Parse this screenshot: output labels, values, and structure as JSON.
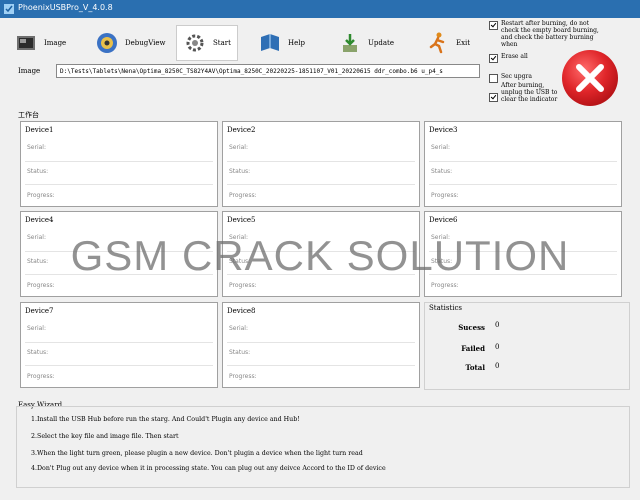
{
  "window": {
    "title": "PhoenixUSBPro_V_4.0.8"
  },
  "toolbar": {
    "image": "Image",
    "debugview": "DebugView",
    "start": "Start",
    "help": "Help",
    "update": "Update",
    "exit": "Exit"
  },
  "image_field": {
    "label": "Image",
    "value": "D:\\Tests\\Tablets\\Nena\\Optima_8250C_TS82Y4AV\\Optima_8250C_20220225-1851107_V01_20220615 ddr_combo.b6 u_p4_s"
  },
  "options": {
    "check_board": {
      "text": "Restart after burning, do not check the empty board burning, and check the battery burning when",
      "checked": true
    },
    "erase_all": {
      "text": "Erase all",
      "checked": true
    },
    "sec_upgrade": {
      "text": "Sec upgra",
      "checked": false
    },
    "unplug": {
      "text": "After burning, unplug the USB to clear the indicator",
      "checked": true
    }
  },
  "work_group_label": "工作台",
  "devices": [
    {
      "name": "Device1",
      "serial": "Serial:",
      "status": "Status:",
      "progress": "Progress:"
    },
    {
      "name": "Device2",
      "serial": "Serial:",
      "status": "Status:",
      "progress": "Progress:"
    },
    {
      "name": "Device3",
      "serial": "Serial:",
      "status": "Status:",
      "progress": "Progress:"
    },
    {
      "name": "Device4",
      "serial": "Serial:",
      "status": "Status:",
      "progress": "Progress:"
    },
    {
      "name": "Device5",
      "serial": "Serial:",
      "status": "Status:",
      "progress": "Progress:"
    },
    {
      "name": "Device6",
      "serial": "Serial:",
      "status": "Status:",
      "progress": "Progress:"
    },
    {
      "name": "Device7",
      "serial": "Serial:",
      "status": "Status:",
      "progress": "Progress:"
    },
    {
      "name": "Device8",
      "serial": "Serial:",
      "status": "Status:",
      "progress": "Progress:"
    }
  ],
  "statistics": {
    "title": "Statistics",
    "success_label": "Sucess",
    "success_value": "0",
    "failed_label": "Failed",
    "failed_value": "0",
    "total_label": "Total",
    "total_value": "0"
  },
  "wizard": {
    "title": "Easy Wizard",
    "steps": [
      "1.Install the USB Hub before run the starg. And Could't Plugin any device and Hub!",
      "2.Select the key file and image file. Then start",
      "3.When the light turn green, please plugin a new device. Don't plugin a device when the light turn read",
      "4.Don't Plug out any device when it in processing state. You can plug out any deivce Accord to the ID of device"
    ]
  },
  "watermark": "GSM CRACK SOLUTION",
  "colors": {
    "titlebar": "#2a6fb0",
    "stop_red": "#e0262a"
  }
}
